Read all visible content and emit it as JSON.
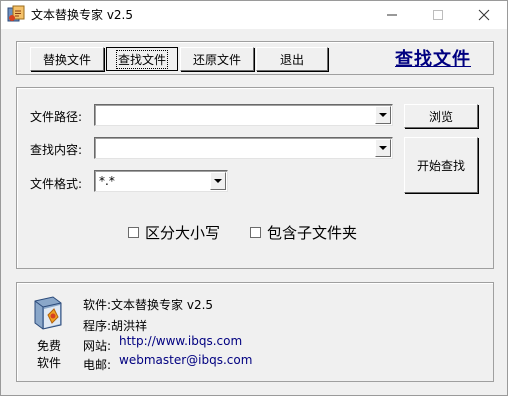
{
  "window": {
    "title": "文本替换专家 v2.5"
  },
  "toolbar": {
    "buttons": [
      "替换文件",
      "查找文件",
      "还原文件",
      "退出"
    ],
    "active_index": 1,
    "mode_title": "查找文件"
  },
  "form": {
    "path_label": "文件路径:",
    "path_value": "",
    "content_label": "查找内容:",
    "content_value": "",
    "format_label": "文件格式:",
    "format_value": "*.*",
    "browse_label": "浏览",
    "search_label": "开始查找",
    "case_label": "区分大小写",
    "case_checked": false,
    "subfolder_label": "包含子文件夹",
    "subfolder_checked": false
  },
  "info": {
    "free_line1": "免费",
    "free_line2": "软件",
    "software": "软件:文本替换专家 v2.5",
    "author": "程序:胡洪祥",
    "website_label": "网站:",
    "website": "http://www.ibqs.com",
    "email_label": "电邮:",
    "email": "webmaster@ibqs.com"
  },
  "colors": {
    "accent": "#000080",
    "face": "#f0f0f0"
  }
}
